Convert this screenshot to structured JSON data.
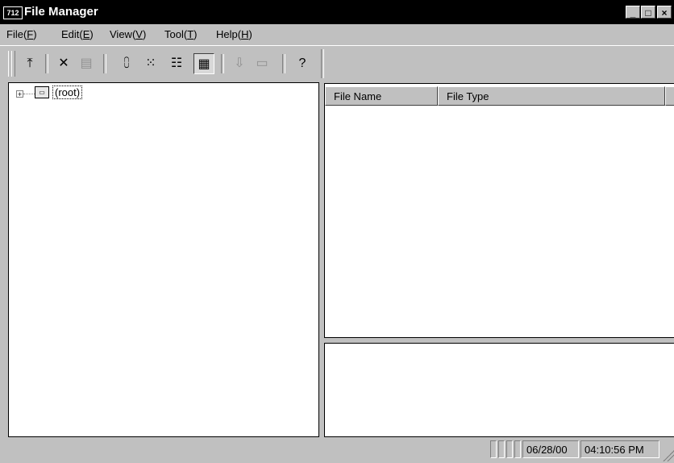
{
  "window": {
    "app_icon_text": "712",
    "title": "File Manager",
    "minimize_symbol": "_",
    "maximize_symbol": "□",
    "close_symbol": "×"
  },
  "menu": {
    "file": {
      "label": "File(",
      "key": "F",
      "close": ")"
    },
    "edit": {
      "label": "Edit(",
      "key": "E",
      "close": ")"
    },
    "view": {
      "label": "View(",
      "key": "V",
      "close": ")"
    },
    "tool": {
      "label": "Tool(",
      "key": "T",
      "close": ")"
    },
    "help": {
      "label": "Help(",
      "key": "H",
      "close": ")"
    }
  },
  "toolbar": {
    "up_folder": "⤒",
    "delete": "✕",
    "properties": "▤",
    "large_icons": "⩇",
    "small_icons": "⁙",
    "list_view": "☷",
    "details_view": "▦",
    "import": "⇩",
    "comment": "▭",
    "help": "?"
  },
  "tree": {
    "expander": "+",
    "root_icon": "▭",
    "root_label": "(root)"
  },
  "list": {
    "columns": [
      "File Name",
      "File Type"
    ]
  },
  "status": {
    "date": "06/28/00",
    "time": "04:10:56 PM"
  }
}
